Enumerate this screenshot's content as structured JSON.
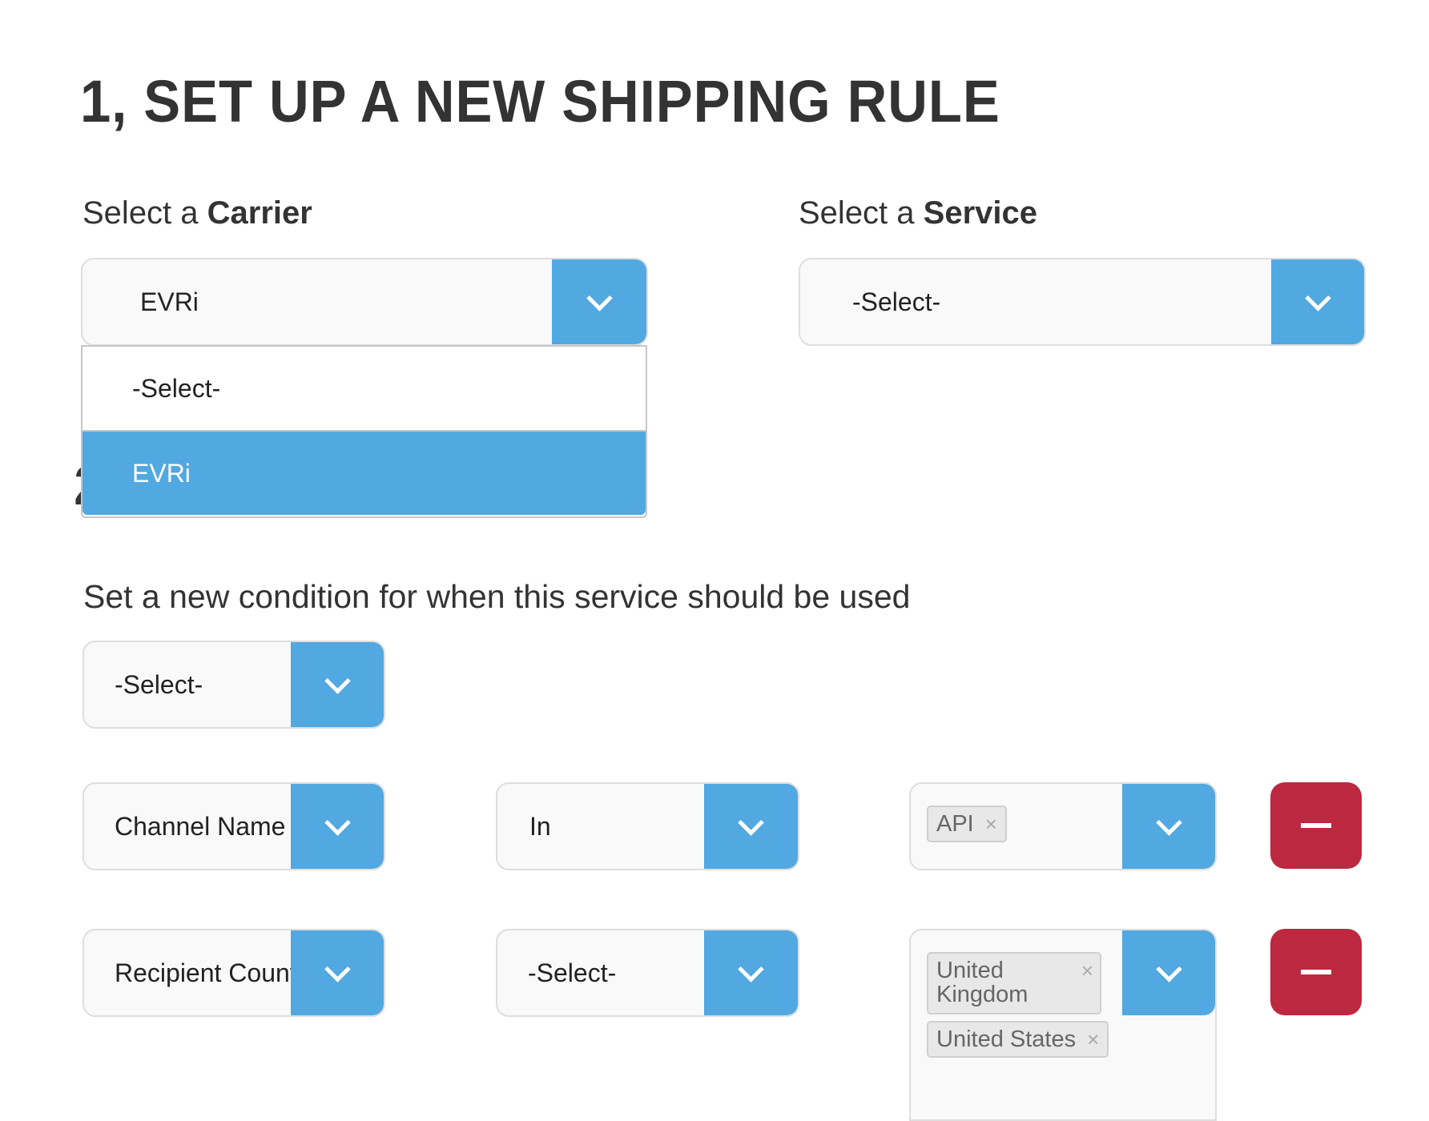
{
  "page": {
    "title": "1, SET UP A NEW SHIPPING RULE",
    "hidden_heading": "2"
  },
  "carrier": {
    "label_prefix": "Select a ",
    "label_bold": "Carrier",
    "value": "EVRi",
    "dropdown_open": true,
    "options": [
      {
        "label": "-Select-",
        "highlighted": false
      },
      {
        "label": "EVRi",
        "highlighted": true
      }
    ]
  },
  "service": {
    "label_prefix": "Select a ",
    "label_bold": "Service",
    "value": "-Select-"
  },
  "conditions": {
    "heading": "Set a new condition for when this service should be used",
    "new_condition_select": "-Select-",
    "rows": [
      {
        "field": "Channel Name",
        "operator": "In",
        "values": [
          "API"
        ]
      },
      {
        "field": "Recipient Country",
        "operator": "-Select-",
        "values": [
          "United Kingdom",
          "United States"
        ]
      }
    ],
    "remove_label": "—"
  },
  "icons": {
    "dropdown_arrow": "chevron-down-icon",
    "remove": "minus-icon",
    "tag_remove": "close-icon",
    "tag_remove_glyph": "×"
  },
  "colors": {
    "accent_blue": "#52a8e0",
    "danger_red": "#bc2840",
    "text_dark": "#333333",
    "field_bg": "#f9f9f9",
    "tag_bg": "#e8e8e8"
  }
}
